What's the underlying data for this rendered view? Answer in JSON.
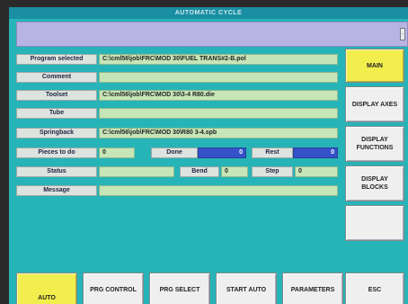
{
  "window": {
    "title": "AUTOMATIC CYCLE"
  },
  "fields": {
    "program_selected": {
      "label": "Program selected",
      "value": "C:\\cml56\\job\\FRC\\MOD 30\\FUEL TRANS#2-B.pol"
    },
    "comment": {
      "label": "Comment",
      "value": ""
    },
    "toolset": {
      "label": "Toolset",
      "value": "C:\\cml56\\job\\FRC\\MOD 30\\3-4 R80.die"
    },
    "tube": {
      "label": "Tube",
      "value": ""
    },
    "springback": {
      "label": "Springback",
      "value": "C:\\cml56\\job\\FRC\\MOD 30\\R80 3-4.spb"
    },
    "pieces_to_do": {
      "label": "Pieces to do",
      "value": "0"
    },
    "done": {
      "label": "Done",
      "value": "0"
    },
    "rest": {
      "label": "Rest",
      "value": "0"
    },
    "status": {
      "label": "Status",
      "value": ""
    },
    "bend": {
      "label": "Bend",
      "value": "0"
    },
    "step": {
      "label": "Step",
      "value": "0"
    },
    "message": {
      "label": "Message",
      "value": ""
    }
  },
  "side_buttons": {
    "main": "MAIN",
    "display_axes": "DISPLAY AXES",
    "display_functions": "DISPLAY FUNCTIONS",
    "display_blocks": "DISPLAY BLOCKS",
    "blank": ""
  },
  "bottom_buttons": {
    "auto": "AUTO",
    "prg_control": "PRG CONTROL",
    "prg_select": "PRG SELECT",
    "start_auto": "START AUTO",
    "parameters": "PARAMETERS",
    "esc": "ESC"
  },
  "colors": {
    "background": "#26b4b8",
    "active_button": "#f2ee4e",
    "counter_bar": "#3551c9",
    "field": "#c7e6b8",
    "message_bar": "#b7b3e3"
  }
}
